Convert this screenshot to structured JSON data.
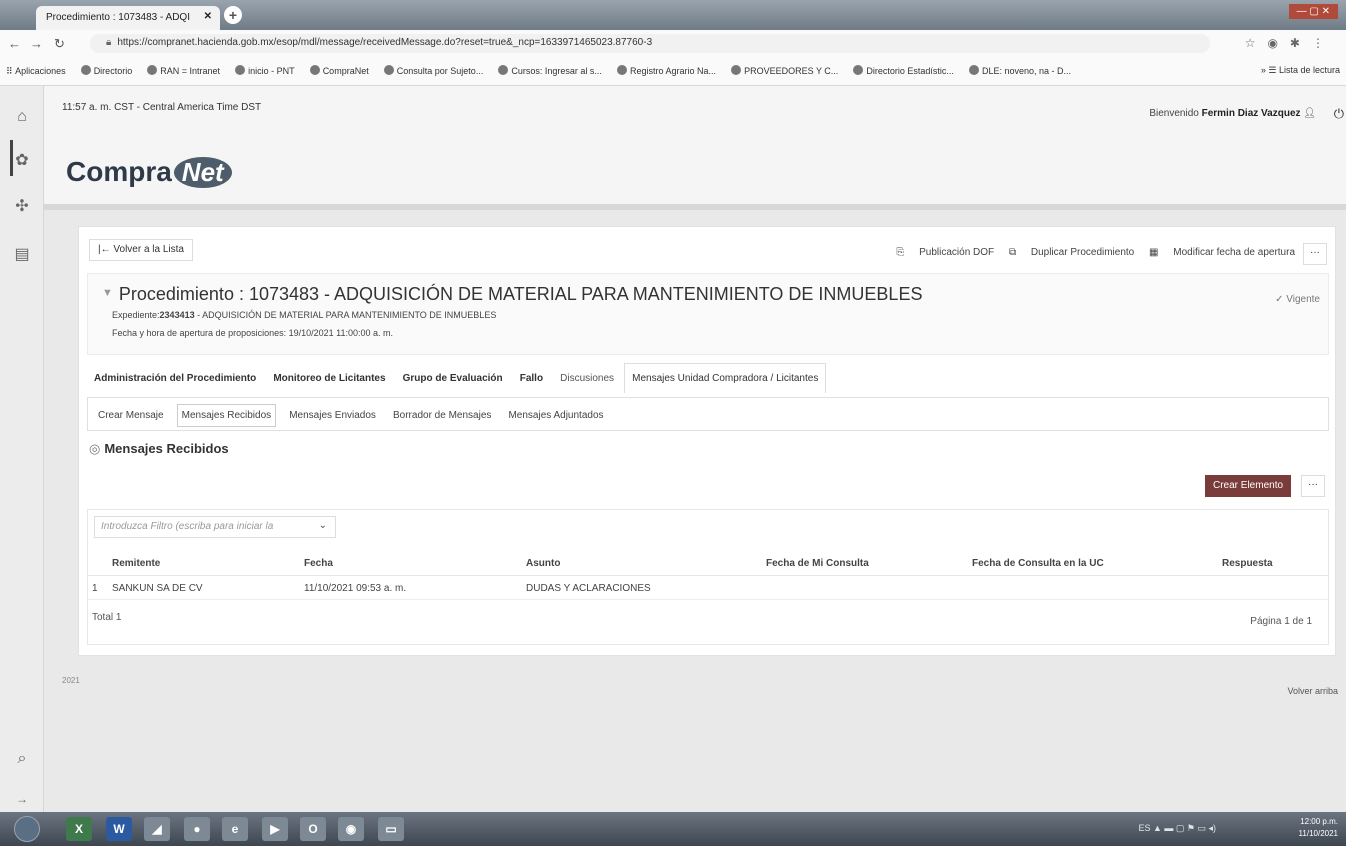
{
  "browser": {
    "tab_title": "Procedimiento : 1073483 - ADQI",
    "tab_close": "✕",
    "new_tab": "+",
    "url": "https://compranet.hacienda.gob.mx/esop/mdl/message/receivedMessage.do?reset=true&_ncp=1633971465023.87760-3",
    "bookmarks": [
      "Aplicaciones",
      "Directorio",
      "RAN = Intranet",
      "inicio - PNT",
      "CompraNet",
      "Consulta por Sujeto...",
      "Cursos: Ingresar al s...",
      "Registro Agrario Na...",
      "PROVEEDORES Y C...",
      "Directorio Estadístic...",
      "DLE: noveno, na - D..."
    ],
    "reading_list": "Lista de lectura"
  },
  "header": {
    "time": "11:57 a. m. CST - Central America Time DST",
    "welcome": "Bienvenido",
    "user": "Fermin Diaz Vazquez",
    "logo_left": "Compra",
    "logo_right": "Net"
  },
  "toolbar": {
    "back": "Volver a la Lista",
    "publicacion": "Publicación DOF",
    "duplicar": "Duplicar Procedimiento",
    "modificar": "Modificar fecha de apertura",
    "more": "···"
  },
  "procedure": {
    "title": "Procedimiento : 1073483 - ADQUISICIÓN DE MATERIAL PARA MANTENIMIENTO DE INMUEBLES",
    "status": "Vigente",
    "expediente_label": "Expediente:",
    "expediente_num": "2343413",
    "expediente_desc": "- ADQUISICIÓN DE MATERIAL PARA MANTENIMIENTO DE INMUEBLES",
    "fecha": "Fecha y hora de apertura de proposiciones: 19/10/2021 11:00:00 a. m."
  },
  "tabs": [
    "Administración del Procedimiento",
    "Monitoreo de Licitantes",
    "Grupo de Evaluación",
    "Fallo",
    "Discusiones",
    "Mensajes Unidad Compradora / Licitantes"
  ],
  "subtabs": [
    "Crear Mensaje",
    "Mensajes Recibidos",
    "Mensajes Enviados",
    "Borrador de Mensajes",
    "Mensajes Adjuntados"
  ],
  "section": {
    "title": "Mensajes Recibidos",
    "create_button": "Crear Elemento",
    "more": "···",
    "filter_placeholder": "Introduzca Filtro (escriba para iniciar la",
    "columns": [
      "Remitente",
      "Fecha",
      "Asunto",
      "Fecha de Mi Consulta",
      "Fecha de Consulta en la UC",
      "Respuesta"
    ],
    "rows": [
      {
        "num": "1",
        "remitente": "SANKUN SA DE CV",
        "fecha": "11/10/2021 09:53 a. m.",
        "asunto": "DUDAS Y ACLARACIONES",
        "mi_consulta": "",
        "consulta_uc": "",
        "respuesta": ""
      }
    ],
    "total": "Total 1",
    "pagina": "Página 1 de 1"
  },
  "footer": {
    "year": "2021",
    "volver": "Volver arriba"
  },
  "taskbar": {
    "lang": "ES",
    "time": "12:00 p.m.",
    "date": "11/10/2021"
  },
  "colors": {
    "accent_button": "#7a3b3b",
    "logo": "#2e3a48"
  }
}
